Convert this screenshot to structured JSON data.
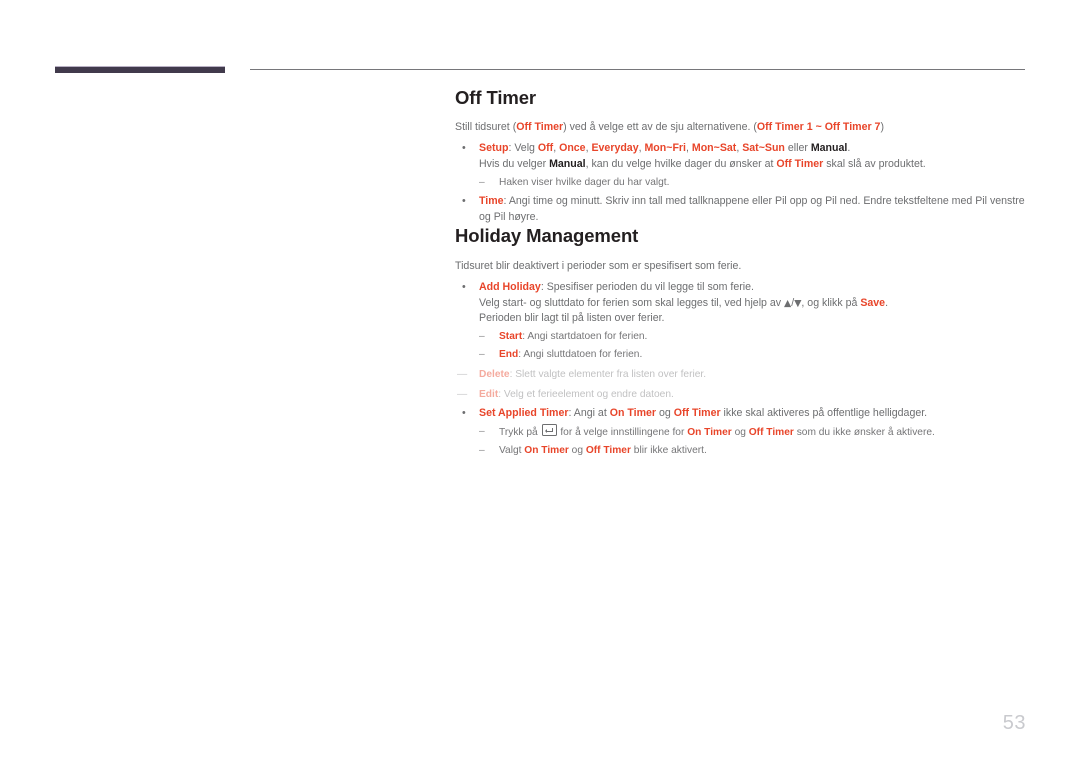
{
  "page": {
    "number": "53",
    "accent_color": "#e8452a",
    "header_bar_color": "#413a4c",
    "body_text_color": "#6d6e70"
  },
  "header": {
    "bar_name": "header-accent-bar",
    "rule_name": "header-rule"
  },
  "sections": [
    {
      "id": "off-timer",
      "title": "Off Timer",
      "intro_parts": [
        {
          "t": "Still tidsuret (",
          "s": "plain"
        },
        {
          "t": "Off Timer",
          "s": "kw"
        },
        {
          "t": ") ved å velge ett av de sju alternativene. (",
          "s": "plain"
        },
        {
          "t": "Off Timer 1 ~ Off Timer 7",
          "s": "kw"
        },
        {
          "t": ")",
          "s": "plain"
        }
      ]
    },
    {
      "id": "holiday-management",
      "title": "Holiday Management",
      "intro_parts": [
        {
          "t": "Tidsuret blir deaktivert i perioder som er spesifisert som ferie.",
          "s": "plain"
        }
      ]
    }
  ],
  "off_timer_items": [
    {
      "name": "setup",
      "bullet": "•",
      "parts": [
        {
          "t": "Setup",
          "s": "kw"
        },
        {
          "t": ": Velg ",
          "s": "plain"
        },
        {
          "t": "Off",
          "s": "kw"
        },
        {
          "t": ", ",
          "s": "plain"
        },
        {
          "t": "Once",
          "s": "kw"
        },
        {
          "t": ", ",
          "s": "plain"
        },
        {
          "t": "Everyday",
          "s": "kw"
        },
        {
          "t": ", ",
          "s": "plain"
        },
        {
          "t": "Mon~Fri",
          "s": "kw"
        },
        {
          "t": ", ",
          "s": "plain"
        },
        {
          "t": "Mon~Sat",
          "s": "kw"
        },
        {
          "t": ", ",
          "s": "plain"
        },
        {
          "t": "Sat~Sun",
          "s": "kw"
        },
        {
          "t": " eller ",
          "s": "plain"
        },
        {
          "t": "Manual",
          "s": "kwd"
        },
        {
          "t": ".",
          "s": "plain"
        }
      ],
      "continuation": [
        {
          "t": "Hvis du velger ",
          "s": "plain"
        },
        {
          "t": "Manual",
          "s": "kwd"
        },
        {
          "t": ", kan du velge hvilke dager du ønsker at ",
          "s": "plain"
        },
        {
          "t": "Off Timer",
          "s": "kw"
        },
        {
          "t": " skal slå av produktet.",
          "s": "plain"
        }
      ],
      "subitems": [
        {
          "name": "haken-viser",
          "dash": "–",
          "parts": [
            {
              "t": "Haken viser hvilke dager du har valgt.",
              "s": "plain"
            }
          ]
        }
      ]
    },
    {
      "name": "time",
      "bullet": "•",
      "parts": [
        {
          "t": "Time",
          "s": "kw"
        },
        {
          "t": ": Angi time og minutt. Skriv inn tall med tallknappene eller Pil opp og Pil ned. Endre tekstfeltene med Pil venstre og Pil høyre.",
          "s": "plain"
        }
      ],
      "continuation": [],
      "subitems": []
    }
  ],
  "holiday_items": [
    {
      "name": "add-holiday",
      "bullet": "•",
      "parts": [
        {
          "t": "Add Holiday",
          "s": "kw"
        },
        {
          "t": ": Spesifiser perioden du vil legge til som ferie.",
          "s": "plain"
        }
      ],
      "continuation": [
        {
          "t": "Velg start- og sluttdato for ferien som skal legges til, ved hjelp av ",
          "s": "plain"
        },
        {
          "t": "▲",
          "s": "glyph"
        },
        {
          "t": "/",
          "s": "plain"
        },
        {
          "t": "▼",
          "s": "glyph"
        },
        {
          "t": ", og klikk på ",
          "s": "plain"
        },
        {
          "t": "Save",
          "s": "kw"
        },
        {
          "t": ".",
          "s": "plain"
        }
      ],
      "continuation2": [
        {
          "t": "Perioden blir lagt til på listen over ferier.",
          "s": "plain"
        }
      ],
      "subitems": [
        {
          "name": "start",
          "dash": "–",
          "parts": [
            {
              "t": "Start",
              "s": "kw"
            },
            {
              "t": ": Angi startdatoen for ferien.",
              "s": "plain"
            }
          ]
        },
        {
          "name": "end",
          "dash": "–",
          "parts": [
            {
              "t": "End",
              "s": "kw"
            },
            {
              "t": ": Angi sluttdatoen for ferien.",
              "s": "plain"
            }
          ]
        }
      ],
      "ghost_subitems": [
        {
          "name": "delete",
          "dash": "—",
          "parts": [
            {
              "t": "Delete",
              "s": "kw"
            },
            {
              "t": ": Slett valgte elementer fra listen over ferier.",
              "s": "plain"
            }
          ]
        },
        {
          "name": "edit",
          "dash": "—",
          "parts": [
            {
              "t": "Edit",
              "s": "kw"
            },
            {
              "t": ": Velg et ferieelement og endre datoen.",
              "s": "plain"
            }
          ]
        }
      ]
    },
    {
      "name": "set-applied-timer",
      "bullet": "•",
      "parts": [
        {
          "t": "Set Applied Timer",
          "s": "kw"
        },
        {
          "t": ": Angi at ",
          "s": "plain"
        },
        {
          "t": "On Timer",
          "s": "kw"
        },
        {
          "t": " og ",
          "s": "plain"
        },
        {
          "t": "Off Timer",
          "s": "kw"
        },
        {
          "t": " ikke skal aktiveres på offentlige helligdager.",
          "s": "plain"
        }
      ],
      "continuation": [],
      "subitems": [
        {
          "name": "trykk-pa-enter",
          "dash": "–",
          "parts": [
            {
              "t": "Trykk på ",
              "s": "plain"
            },
            {
              "t": "",
              "s": "enter-key-icon"
            },
            {
              "t": " for å velge innstillingene for ",
              "s": "plain"
            },
            {
              "t": "On Timer",
              "s": "kw"
            },
            {
              "t": " og ",
              "s": "plain"
            },
            {
              "t": "Off Timer",
              "s": "kw"
            },
            {
              "t": " som du ikke ønsker å aktivere.",
              "s": "plain"
            }
          ]
        },
        {
          "name": "valgt-timer",
          "dash": "–",
          "parts": [
            {
              "t": "Valgt ",
              "s": "plain"
            },
            {
              "t": "On Timer",
              "s": "kw"
            },
            {
              "t": " og ",
              "s": "plain"
            },
            {
              "t": "Off Timer",
              "s": "kw"
            },
            {
              "t": " blir ikke aktivert.",
              "s": "plain"
            }
          ]
        }
      ]
    }
  ]
}
